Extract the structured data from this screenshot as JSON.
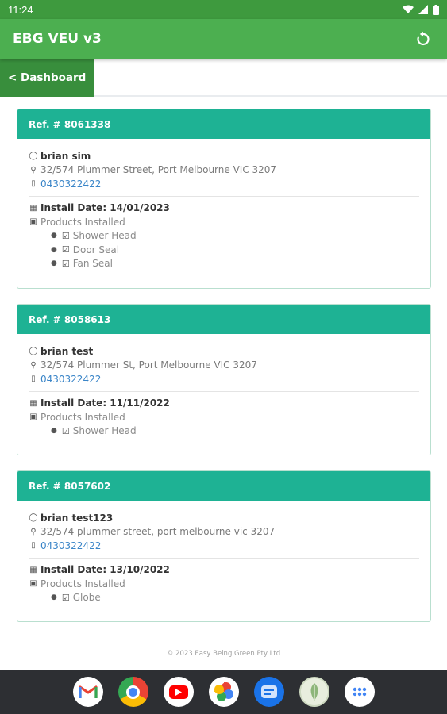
{
  "status": {
    "time": "11:24"
  },
  "app": {
    "title": "EBG VEU v3",
    "back_label": "< Dashboard"
  },
  "cards": [
    {
      "ref": "Ref. # 8061338",
      "name": "brian sim",
      "address": "32/574 Plummer Street, Port Melbourne VIC 3207",
      "phone": "0430322422",
      "install_date": "Install Date: 14/01/2023",
      "products_label": "Products Installed",
      "products": [
        "Shower Head",
        "Door Seal",
        "Fan Seal"
      ]
    },
    {
      "ref": "Ref. # 8058613",
      "name": "brian test",
      "address": "32/574 Plummer St, Port Melbourne VIC 3207",
      "phone": "0430322422",
      "install_date": "Install Date: 11/11/2022",
      "products_label": "Products Installed",
      "products": [
        "Shower Head"
      ]
    },
    {
      "ref": "Ref. # 8057602",
      "name": "brian test123",
      "address": "32/574 plummer street, port melbourne vic 3207",
      "phone": "0430322422",
      "install_date": "Install Date: 13/10/2022",
      "products_label": "Products Installed",
      "products": [
        "Globe"
      ]
    }
  ],
  "footer": {
    "copyright": "© 2023 Easy Being Green Pty Ltd"
  },
  "dock": [
    "gmail-icon",
    "chrome-icon",
    "youtube-icon",
    "photos-icon",
    "messages-icon",
    "app-leaf-icon",
    "app-drawer-icon"
  ],
  "colors": {
    "appbar": "#4caf50",
    "back_button": "#388e3c",
    "card_header": "#1eb294",
    "link": "#3a85c8"
  }
}
